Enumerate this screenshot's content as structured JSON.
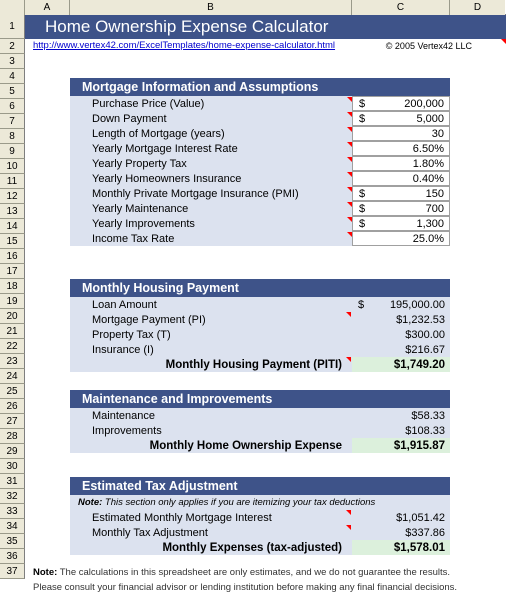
{
  "spreadsheet": {
    "columns": [
      "A",
      "B",
      "C",
      "D"
    ],
    "rows": [
      "1",
      "2",
      "3",
      "4",
      "5",
      "6",
      "7",
      "8",
      "9",
      "10",
      "11",
      "12",
      "13",
      "14",
      "15",
      "16",
      "17",
      "18",
      "19",
      "20",
      "21",
      "22",
      "23",
      "24",
      "25",
      "26",
      "27",
      "28",
      "29",
      "30",
      "31",
      "32",
      "33",
      "34",
      "35",
      "36",
      "37"
    ]
  },
  "header": {
    "title": "Home Ownership Expense Calculator",
    "url": "http://www.vertex42.com/ExcelTemplates/home-expense-calculator.html",
    "copyright": "© 2005 Vertex42 LLC"
  },
  "colors": {
    "header_blue": "#3e5389",
    "panel_blue": "#dce2ef",
    "result_green": "#dcf0dc",
    "link_blue": "#0000cd",
    "comment_red": "#ff0000",
    "colheader_tan": "#ece9d8"
  },
  "sections": [
    {
      "title": "Mortgage Information and Assumptions",
      "rows": [
        {
          "label": "Purchase Price (Value)",
          "currency": "$",
          "value": "200,000",
          "kind": "input",
          "comment": true
        },
        {
          "label": "Down Payment",
          "currency": "$",
          "value": "5,000",
          "kind": "input",
          "comment": true
        },
        {
          "label": "Length of Mortgage (years)",
          "currency": "",
          "value": "30",
          "kind": "input",
          "comment": true
        },
        {
          "label": "Yearly Mortgage Interest Rate",
          "currency": "",
          "value": "6.50%",
          "kind": "input",
          "comment": true
        },
        {
          "label": "Yearly Property Tax",
          "currency": "",
          "value": "1.80%",
          "kind": "input",
          "comment": true
        },
        {
          "label": "Yearly Homeowners Insurance",
          "currency": "",
          "value": "0.40%",
          "kind": "input",
          "comment": true
        },
        {
          "label": "Monthly Private Mortgage Insurance (PMI)",
          "currency": "$",
          "value": "150",
          "kind": "input",
          "comment": true
        },
        {
          "label": "Yearly Maintenance",
          "currency": "$",
          "value": "700",
          "kind": "input",
          "comment": true
        },
        {
          "label": "Yearly Improvements",
          "currency": "$",
          "value": "1,300",
          "kind": "input",
          "comment": true
        },
        {
          "label": "Income Tax Rate",
          "currency": "",
          "value": "25.0%",
          "kind": "input",
          "comment": true
        }
      ]
    },
    {
      "title": "Monthly Housing Payment",
      "rows": [
        {
          "label": "Loan Amount",
          "currency": "$",
          "value": "195,000.00",
          "kind": "calc",
          "comment": false
        },
        {
          "label": "Mortgage Payment (PI)",
          "currency": "",
          "value": "$1,232.53",
          "kind": "calc",
          "comment": true
        },
        {
          "label": "Property Tax (T)",
          "currency": "",
          "value": "$300.00",
          "kind": "calc",
          "comment": false
        },
        {
          "label": "Insurance (I)",
          "currency": "",
          "value": "$216.67",
          "kind": "calc",
          "comment": false
        },
        {
          "label": "Monthly Housing Payment (PITI)",
          "currency": "",
          "value": "$1,749.20",
          "kind": "total",
          "comment": true
        }
      ]
    },
    {
      "title": "Maintenance and Improvements",
      "rows": [
        {
          "label": "Maintenance",
          "currency": "",
          "value": "$58.33",
          "kind": "calc",
          "comment": false
        },
        {
          "label": "Improvements",
          "currency": "",
          "value": "$108.33",
          "kind": "calc",
          "comment": false
        },
        {
          "label": "Monthly Home Ownership Expense",
          "currency": "",
          "value": "$1,915.87",
          "kind": "total",
          "comment": false
        }
      ]
    },
    {
      "title": "Estimated Tax Adjustment",
      "note_bold": "Note:",
      "note_text": " This section only applies if you are itemizing your tax deductions",
      "rows": [
        {
          "label": "Estimated Monthly Mortgage Interest",
          "currency": "",
          "value": "$1,051.42",
          "kind": "calc",
          "comment": true
        },
        {
          "label": "Monthly Tax Adjustment",
          "currency": "",
          "value": "$337.86",
          "kind": "calc",
          "comment": true
        },
        {
          "label": "Monthly Expenses (tax-adjusted)",
          "currency": "",
          "value": "$1,578.01",
          "kind": "total",
          "comment": false
        }
      ]
    }
  ],
  "footer": {
    "note_bold": "Note:",
    "line1": "  The calculations in this spreadsheet are only estimates, and we do not guarantee the results.",
    "line2": "Please consult your financial advisor or lending institution before making any final financial decisions."
  }
}
